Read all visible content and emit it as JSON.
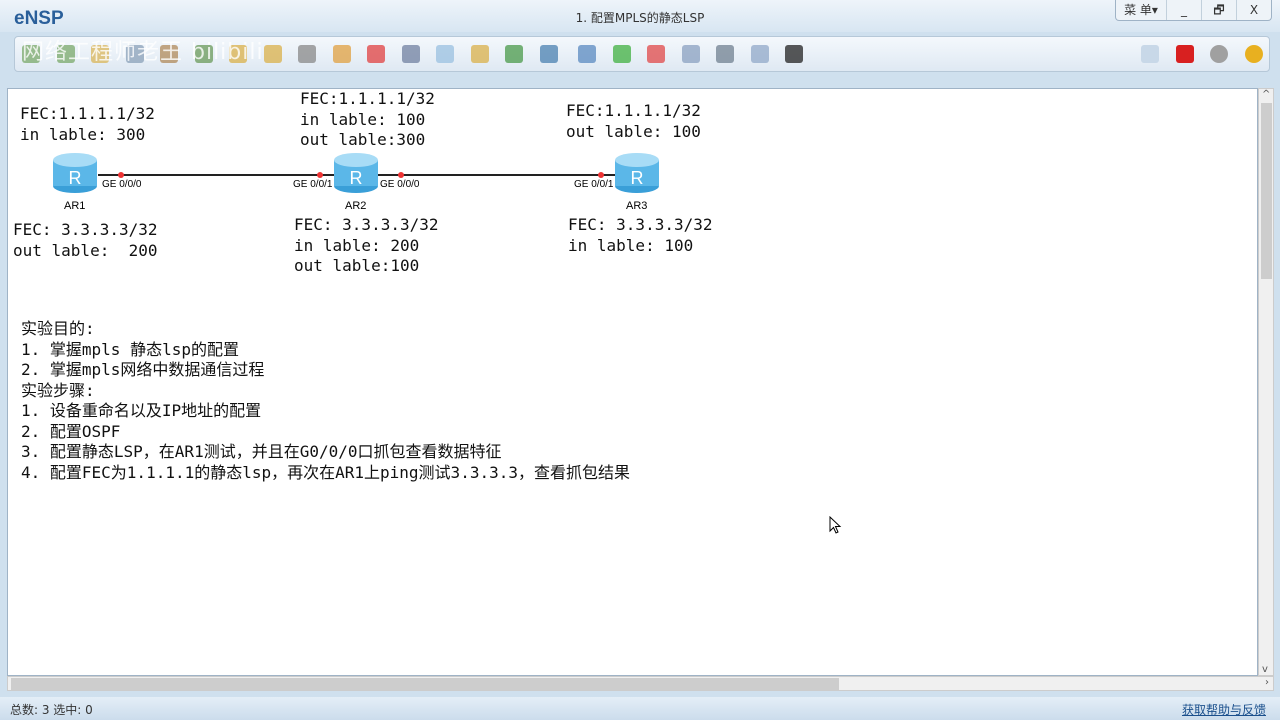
{
  "app": {
    "name": "eNSP",
    "title": "1. 配置MPLS的静态LSP",
    "menu_label": "菜 单▾",
    "minimize": "_",
    "restore": "🗗",
    "close": "X"
  },
  "watermark": "网络工程师老王 bilibili",
  "toolbar": {
    "left_icons": [
      "new-topology",
      "new-lab",
      "open",
      "save",
      "save-as",
      "print",
      "undo",
      "redo",
      "select",
      "pan",
      "delete",
      "delete-link",
      "text-note",
      "rectangle",
      "zoom-in",
      "zoom-out",
      "fit-1to1",
      "start-device",
      "stop-device",
      "capture",
      "topology",
      "grid",
      "console"
    ],
    "right_icons": [
      "chat",
      "huawei",
      "settings",
      "help"
    ]
  },
  "topology": {
    "routers": [
      {
        "name": "AR1",
        "ports": [
          "GE 0/0/0"
        ]
      },
      {
        "name": "AR2",
        "ports": [
          "GE 0/0/1",
          "GE 0/0/0"
        ]
      },
      {
        "name": "AR3",
        "ports": [
          "GE 0/0/1"
        ]
      }
    ],
    "labels": {
      "ar1_top": [
        "FEC:1.1.1.1/32",
        "in lable: 300"
      ],
      "ar2_top": [
        "FEC:1.1.1.1/32",
        "in lable: 100",
        "out lable:300"
      ],
      "ar3_top": [
        "FEC:1.1.1.1/32",
        "out lable: 100"
      ],
      "ar1_bottom": [
        "FEC: 3.3.3.3/32",
        "out lable:  200"
      ],
      "ar2_bottom": [
        "FEC: 3.3.3.3/32",
        "in lable: 200",
        "out lable:100"
      ],
      "ar3_bottom": [
        "FEC: 3.3.3.3/32",
        "in lable: 100"
      ]
    }
  },
  "notes": [
    "实验目的:",
    "1. 掌握mpls 静态lsp的配置",
    "2. 掌握mpls网络中数据通信过程",
    "实验步骤:",
    "1. 设备重命名以及IP地址的配置",
    "2. 配置OSPF",
    "3. 配置静态LSP，在AR1测试，并且在G0/0/0口抓包查看数据特征",
    "4. 配置FEC为1.1.1.1的静态lsp，再次在AR1上ping测试3.3.3.3，查看抓包结果"
  ],
  "status": {
    "left": "总数: 3 选中: 0",
    "right": "获取帮助与反馈"
  }
}
